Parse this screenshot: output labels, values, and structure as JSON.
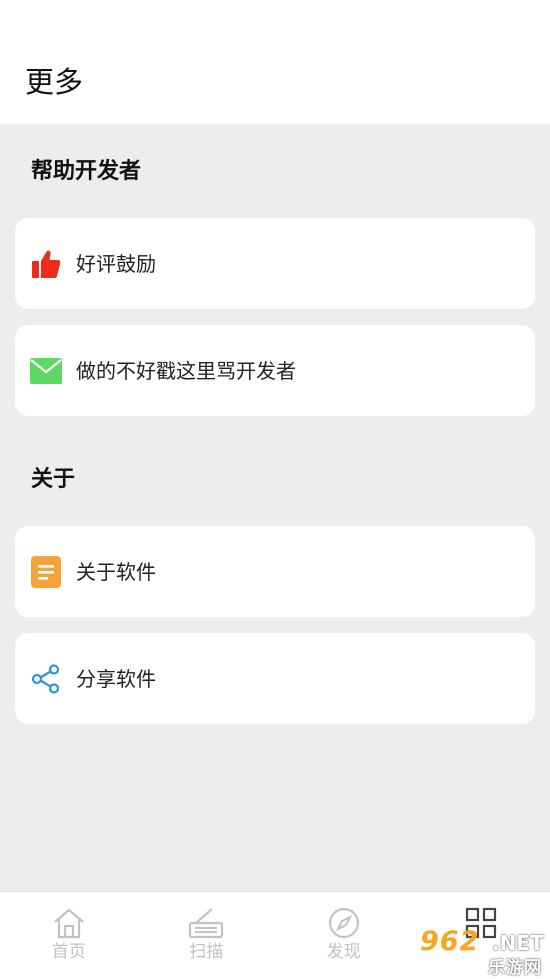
{
  "header": {
    "title": "更多"
  },
  "sections": {
    "help": {
      "title": "帮助开发者",
      "items": [
        {
          "label": "好评鼓励",
          "icon": "thumbs-up-icon",
          "color": "#ee2a1b"
        },
        {
          "label": "做的不好戳这里骂开发者",
          "icon": "mail-icon",
          "color": "#5ed862"
        }
      ]
    },
    "about": {
      "title": "关于",
      "items": [
        {
          "label": "关于软件",
          "icon": "document-icon",
          "color": "#f5a33a"
        },
        {
          "label": "分享软件",
          "icon": "share-icon",
          "color": "#2b97d8"
        }
      ]
    }
  },
  "tabbar": {
    "tabs": [
      {
        "label": "首页",
        "icon": "home-icon"
      },
      {
        "label": "扫描",
        "icon": "scanner-icon"
      },
      {
        "label": "发现",
        "icon": "compass-icon"
      },
      {
        "label": "",
        "icon": "grid-icon"
      }
    ]
  },
  "watermark": {
    "number": "962",
    "suffix": ".NET",
    "text": "乐游网"
  }
}
